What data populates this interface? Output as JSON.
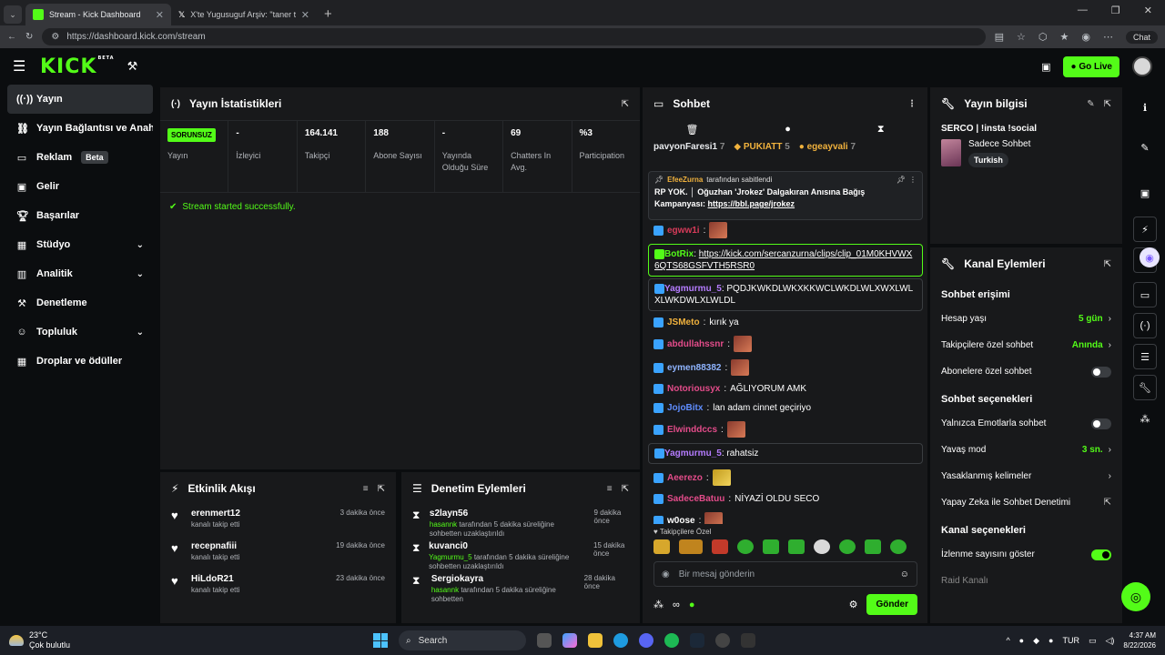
{
  "browser": {
    "tabs": [
      {
        "title": "Stream - Kick Dashboard",
        "active": true
      },
      {
        "title": "X'te Yugusuguf Arşiv: \"taner tolga",
        "active": false
      }
    ],
    "url": "https://dashboard.kick.com/stream",
    "chat_label": "Chat"
  },
  "header": {
    "logo": "KICK",
    "logo_badge": "BETA",
    "go_live": "Go Live"
  },
  "sidebar": {
    "items": [
      {
        "label": "Yayın",
        "icon": "broadcast-icon"
      },
      {
        "label": "Yayın Bağlantısı ve Anahtar",
        "icon": "link-icon"
      },
      {
        "label": "Reklam",
        "icon": "ad-icon",
        "badge": "Beta"
      },
      {
        "label": "Gelir",
        "icon": "wallet-icon"
      },
      {
        "label": "Başarılar",
        "icon": "trophy-icon"
      },
      {
        "label": "Stüdyo",
        "icon": "studio-icon"
      },
      {
        "label": "Analitik",
        "icon": "analytics-icon"
      },
      {
        "label": "Denetleme",
        "icon": "moderation-icon"
      },
      {
        "label": "Topluluk",
        "icon": "community-icon"
      },
      {
        "label": "Droplar ve ödüller",
        "icon": "drops-icon"
      }
    ]
  },
  "stats": {
    "title": "Yayın İstatistikleri",
    "items": [
      {
        "value": "SORUNSUZ",
        "label": "Yayın"
      },
      {
        "value": "-",
        "label": "İzleyici"
      },
      {
        "value": "164.141",
        "label": "Takipçi"
      },
      {
        "value": "188",
        "label": "Abone Sayısı"
      },
      {
        "value": "-",
        "label": "Yayında Olduğu Süre"
      },
      {
        "value": "69",
        "label": "Chatters In Avg."
      },
      {
        "value": "%3",
        "label": "Participation"
      }
    ],
    "status_message": "Stream started successfully."
  },
  "activity": {
    "title": "Etkinlik Akışı",
    "items": [
      {
        "name": "erenmert12",
        "sub": "kanalı takip etti",
        "time": "3 dakika önce"
      },
      {
        "name": "recepnafiii",
        "sub": "kanalı takip etti",
        "time": "19 dakika önce"
      },
      {
        "name": "HiLdoR21",
        "sub": "kanalı takip etti",
        "time": "23 dakika önce"
      }
    ]
  },
  "moderation": {
    "title": "Denetim Eylemleri",
    "items": [
      {
        "name": "s2layn56",
        "by": "hasannk",
        "sub": "tarafından 5 dakika süreliğine sohbetten uzaklaştırıldı",
        "time": "9 dakika önce"
      },
      {
        "name": "kuvanci0",
        "by": "Yagmurmu_5",
        "sub": "tarafından 5 dakika süreliğine sohbetten uzaklaştırıldı",
        "time": "15 dakika önce"
      },
      {
        "name": "Sergiokayra",
        "by": "hasannk",
        "sub": "tarafından 5 dakika süreliğine sohbetten",
        "time": "28 dakika önce"
      }
    ]
  },
  "chat": {
    "title": "Sohbet",
    "gifters": [
      {
        "name": "pavyonFaresi1",
        "count": "7"
      },
      {
        "name": "PUKIATT",
        "count": "5"
      },
      {
        "name": "egeayvali",
        "count": "7"
      }
    ],
    "pinned": {
      "by": "EfeeZurna",
      "by_suffix": "tarafından sabitlendi",
      "text": "RP YOK. │ Oğuzhan 'Jrokez' Dalgakıran Anısına Bağış Kampanyası:",
      "link": "https://bbl.page/jrokez"
    },
    "messages": [
      {
        "user": "egww1i",
        "color": "#d83b5a",
        "text": "",
        "emote": true
      },
      {
        "user": "BotRix",
        "color": "#53fc18",
        "text": "https://kick.com/sercanzurna/clips/clip_01M0KHVWX6QTS68GSFVTH5RSR0",
        "style": "boxgreen"
      },
      {
        "user": "Yagmurmu_5",
        "color": "#b57cff",
        "text": "PQDJKWKDLWKXKKWCLWKDLWLXWXLWLXLWKDWLXLWLDL",
        "style": "box"
      },
      {
        "user": "JSMeto",
        "color": "#f1b23d",
        "text": "kırık ya"
      },
      {
        "user": "abdullahssnr",
        "color": "#e34c8a",
        "text": "",
        "emote": true
      },
      {
        "user": "eymen88382",
        "color": "#8fb4ff",
        "text": "",
        "emote": true
      },
      {
        "user": "Notoriousyx",
        "color": "#e34c8a",
        "text": "AĞLIYORUM AMK"
      },
      {
        "user": "JojoBitx",
        "color": "#5f8dff",
        "text": "lan adam cinnet geçiriyo"
      },
      {
        "user": "Elwinddccs",
        "color": "#e34c8a",
        "text": "",
        "emote": true
      },
      {
        "user": "Yagmurmu_5",
        "color": "#b57cff",
        "text": "rahatsiz",
        "style": "box"
      },
      {
        "user": "Aeerezo",
        "color": "#e34c8a",
        "text": "",
        "emote": true,
        "emote_color": "y"
      },
      {
        "user": "SadeceBatuu",
        "color": "#e34c8a",
        "text": "NİYAZİ OLDU SECO"
      },
      {
        "user": "w0ose",
        "color": "#fff",
        "text": "",
        "emote": true
      }
    ],
    "emote_label": "Takipçilere Özel",
    "input_placeholder": "Bir mesaj gönderin",
    "send": "Gönder"
  },
  "stream_info": {
    "title": "Yayın bilgisi",
    "stream_title": "SERCO | !insta !social",
    "category": "Sadece Sohbet",
    "language": "Turkish"
  },
  "channel_actions": {
    "title": "Kanal Eylemleri",
    "access_h": "Sohbet erişimi",
    "account_age": {
      "label": "Hesap yaşı",
      "value": "5 gün"
    },
    "followers_only": {
      "label": "Takipçilere özel sohbet",
      "value": "Anında"
    },
    "subs_only": {
      "label": "Abonelere özel sohbet"
    },
    "options_h": "Sohbet seçenekleri",
    "emotes_only": {
      "label": "Yalnızca Emotlarla sohbet"
    },
    "slow_mode": {
      "label": "Yavaş mod",
      "value": "3 sn."
    },
    "banned_words": {
      "label": "Yasaklanmış kelimeler"
    },
    "ai_mod": {
      "label": "Yapay Zeka ile Sohbet Denetimi"
    },
    "channel_h": "Kanal seçenekleri",
    "show_views": {
      "label": "İzlenme sayısını göster"
    },
    "raid": {
      "label": "Raid Kanalı"
    }
  },
  "taskbar": {
    "temp": "23°C",
    "weather": "Çok bulutlu",
    "search": "Search",
    "lang": "TUR",
    "time": "4:37 AM",
    "date": "8/22/2026"
  }
}
